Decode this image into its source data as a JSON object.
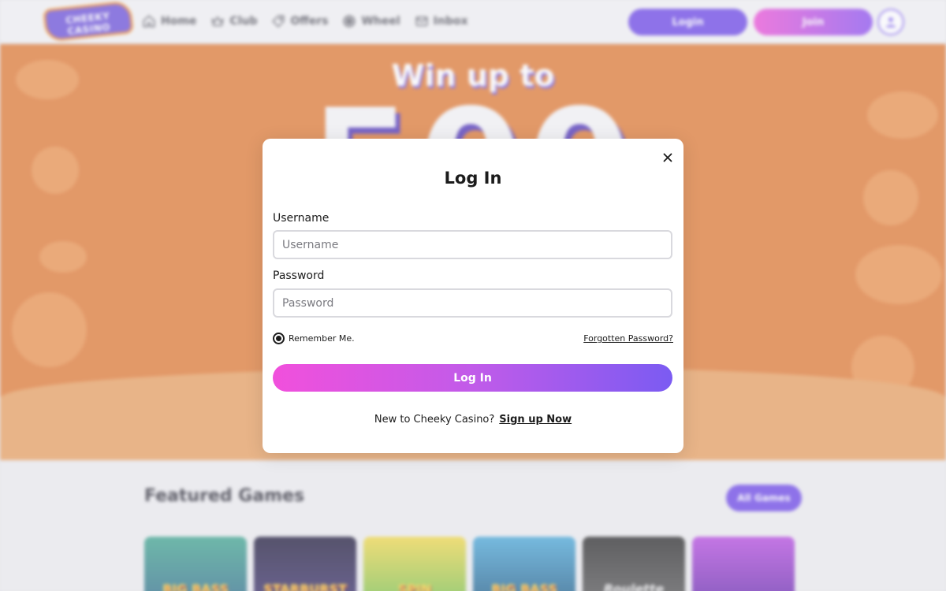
{
  "header": {
    "logo_text": "CHEEKY CASINO",
    "nav": [
      {
        "label": "Home",
        "icon": "home-icon"
      },
      {
        "label": "Club",
        "icon": "crown-icon"
      },
      {
        "label": "Offers",
        "icon": "tag-icon"
      },
      {
        "label": "Wheel",
        "icon": "wheel-icon"
      },
      {
        "label": "Inbox",
        "icon": "mail-icon"
      }
    ],
    "login_label": "Login",
    "join_label": "Join"
  },
  "hero": {
    "title": "Win up to",
    "amount": "500"
  },
  "featured": {
    "title": "Featured Games",
    "all_games_label": "All Games",
    "games": [
      {
        "name": "BIG BASS",
        "color": "#2f8f7a"
      },
      {
        "name": "STARBURST",
        "color": "#2a1f4a"
      },
      {
        "name": "SPIN",
        "color": "#e9c840"
      },
      {
        "name": "BIG BASS",
        "color": "#2a7fb8"
      },
      {
        "name": "Roulette",
        "color": "#3a3a3a"
      },
      {
        "name": "",
        "color": "#9a36c8"
      }
    ]
  },
  "modal": {
    "title": "Log In",
    "username_label": "Username",
    "username_placeholder": "Username",
    "username_value": "",
    "password_label": "Password",
    "password_placeholder": "Password",
    "password_value": "",
    "remember_label": "Remember Me.",
    "remember_checked": true,
    "forgot_label": "Forgotten Password?",
    "submit_label": "Log In",
    "signup_prompt": "New to Cheeky Casino?",
    "signup_link": "Sign up Now"
  },
  "colors": {
    "brand_purple": "#6b45e6",
    "brand_pink": "#ec4fd6",
    "hero_orange": "#e07a34"
  }
}
